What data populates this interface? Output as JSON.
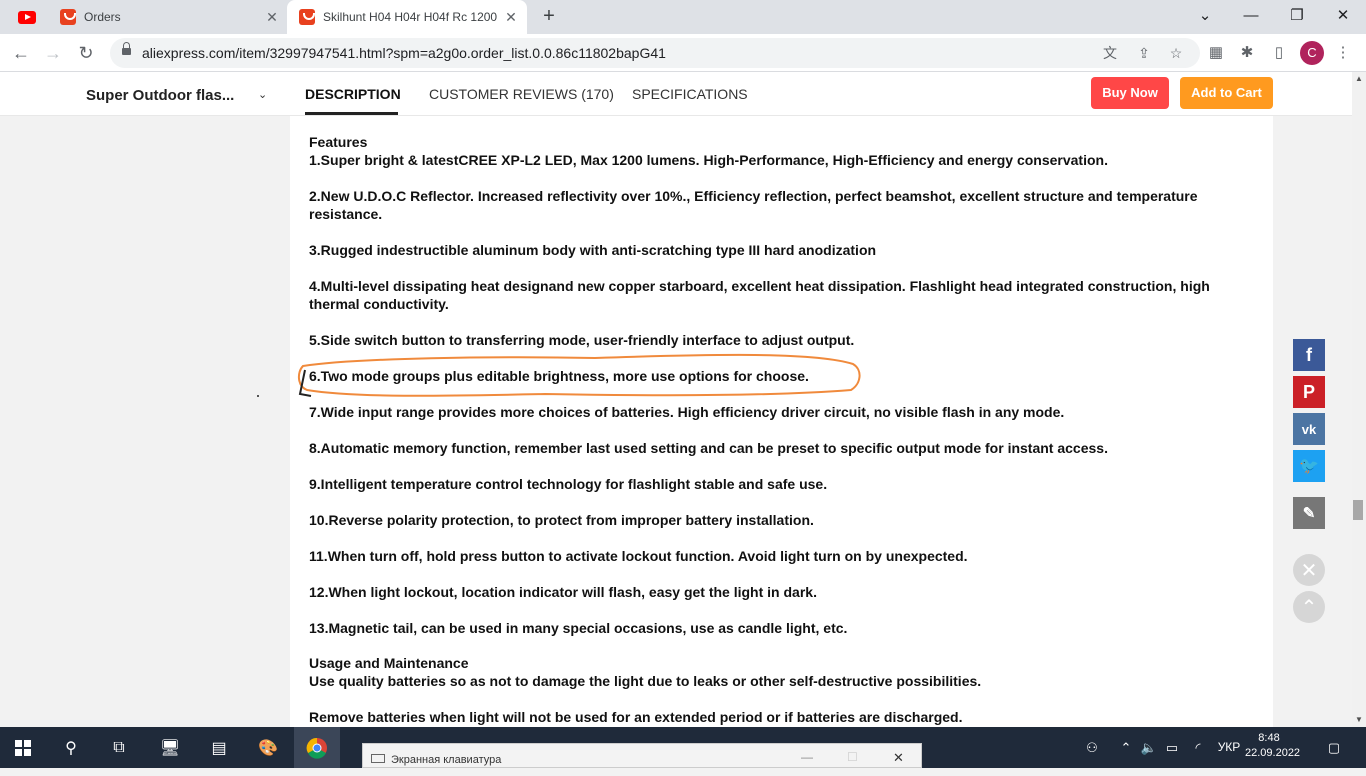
{
  "browser": {
    "tabs": [
      {
        "title": ""
      },
      {
        "title": "Orders"
      },
      {
        "title": "Skilhunt H04 H04r H04f Rc 1200"
      }
    ],
    "url": "aliexpress.com/item/32997947541.html?spm=a2g0o.order_list.0.0.86c11802bapG41",
    "profile_initial": "C"
  },
  "header": {
    "product_short": "Super Outdoor flas...",
    "tabs": [
      "DESCRIPTION",
      "CUSTOMER REVIEWS (170)",
      "SPECIFICATIONS"
    ],
    "buy_now": "Buy Now",
    "add_to_cart": "Add to Cart"
  },
  "description": {
    "features_heading": "Features",
    "features": [
      "1.Super bright & latestCREE XP-L2 LED, Max 1200 lumens. High-Performance, High-Efficiency and energy conservation.",
      "2.New U.D.O.C Reflector. Increased reflectivity over 10%., Efficiency reflection, perfect beamshot, excellent structure and temperature resistance.",
      "3.Rugged indestructible aluminum body with anti-scratching type III hard anodization",
      "4.Multi-level dissipating heat designand new copper starboard, excellent heat dissipation. Flashlight head integrated construction, high thermal conductivity.",
      "5.Side switch button to transferring mode, user-friendly interface to adjust output.",
      "6.Two mode groups plus editable brightness, more use options for choose.",
      "7.Wide input range provides more choices of batteries. High efficiency driver circuit, no visible flash in any mode.",
      "8.Automatic memory function, remember last used setting and can be preset to specific output mode for instant access.",
      "9.Intelligent temperature control technology for flashlight stable and safe use.",
      "10.Reverse polarity protection, to protect from improper battery installation.",
      "11.When turn off, hold press button to activate lockout function. Avoid light turn on by unexpected.",
      "12.When light lockout, location indicator will flash, easy get the light in dark.",
      "13.Magnetic tail, can be used in many special occasions, use as candle light, etc."
    ],
    "usage_heading": "Usage and Maintenance",
    "usage": [
      "Use quality batteries so as not to damage the light due to leaks or other self-destructive possibilities.",
      "Remove batteries when light will not be used for an extended period or if batteries are discharged."
    ]
  },
  "share_icons": [
    "facebook-icon",
    "pinterest-icon",
    "vk-icon",
    "twitter-icon",
    "edit-icon"
  ],
  "taskbar": {
    "osk_title": "Экранная клавиатура",
    "language": "УКР",
    "time": "8:48",
    "date": "22.09.2022"
  },
  "colors": {
    "buy_now": "#ff4747",
    "add_to_cart": "#ff9a1f",
    "annotation": "#f08a3c",
    "facebook": "#3b5998",
    "pinterest": "#cb2027",
    "vk": "#4c75a3",
    "twitter": "#1da1f2"
  }
}
